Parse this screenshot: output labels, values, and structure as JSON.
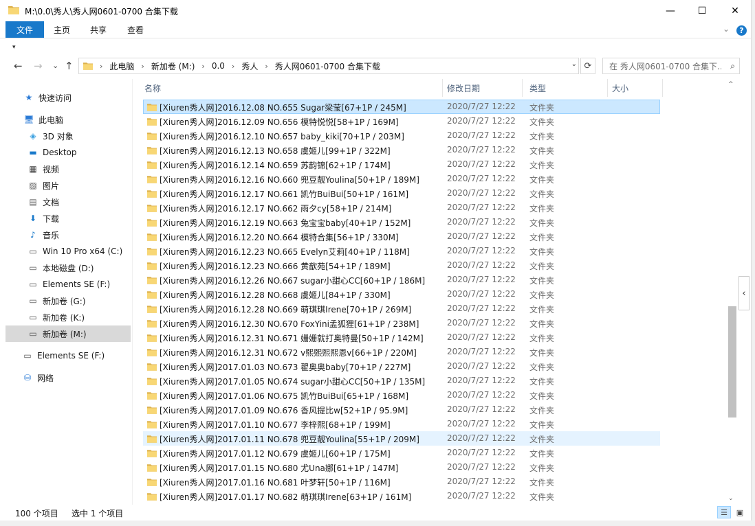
{
  "window": {
    "title": "M:\\0.0\\秀人\\秀人网0601-0700 合集下载",
    "minimize": "—",
    "maximize": "☐",
    "close": "✕"
  },
  "ribbon": {
    "tabs": [
      "文件",
      "主页",
      "共享",
      "查看"
    ],
    "expand": "⌄",
    "help": "?"
  },
  "qat": {
    "arrow": "▾"
  },
  "nav": {
    "back": "←",
    "forward": "→",
    "recent": "⌄",
    "up": "↑",
    "breadcrumbs": [
      "此电脑",
      "新加卷 (M:)",
      "0.0",
      "秀人",
      "秀人网0601-0700 合集下载"
    ],
    "breadcrumb_sep": "›",
    "address_dropdown": "⌄",
    "refresh": "⟳",
    "search_placeholder": "在 秀人网0601-0700 合集下...",
    "search_icon": "⌕"
  },
  "sidebar": {
    "items": [
      {
        "label": "快速访问",
        "icon": "star-icon",
        "glyph": "★",
        "color": "#2b7bd6"
      },
      {
        "label": "此电脑",
        "icon": "computer-icon",
        "glyph": "🖥",
        "color": "#2b7bd6"
      },
      {
        "label": "3D 对象",
        "icon": "3d-objects-icon",
        "glyph": "◈",
        "color": "#3aa0e0"
      },
      {
        "label": "Desktop",
        "icon": "desktop-icon",
        "glyph": "▬",
        "color": "#1979ca"
      },
      {
        "label": "视频",
        "icon": "video-icon",
        "glyph": "▦",
        "color": "#444"
      },
      {
        "label": "图片",
        "icon": "pictures-icon",
        "glyph": "▨",
        "color": "#555"
      },
      {
        "label": "文档",
        "icon": "documents-icon",
        "glyph": "▤",
        "color": "#666"
      },
      {
        "label": "下载",
        "icon": "download-icon",
        "glyph": "⬇",
        "color": "#1979ca"
      },
      {
        "label": "音乐",
        "icon": "music-icon",
        "glyph": "♪",
        "color": "#1979ca"
      },
      {
        "label": "Win 10 Pro x64 (C:)",
        "icon": "windows-drive-icon",
        "glyph": "▭",
        "color": "#555"
      },
      {
        "label": "本地磁盘 (D:)",
        "icon": "drive-icon",
        "glyph": "▭",
        "color": "#555"
      },
      {
        "label": "Elements SE (F:)",
        "icon": "drive-icon",
        "glyph": "▭",
        "color": "#555"
      },
      {
        "label": "新加卷 (G:)",
        "icon": "drive-icon",
        "glyph": "▭",
        "color": "#555"
      },
      {
        "label": "新加卷 (K:)",
        "icon": "drive-icon",
        "glyph": "▭",
        "color": "#555"
      },
      {
        "label": "新加卷 (M:)",
        "icon": "drive-icon",
        "glyph": "▭",
        "color": "#555"
      },
      {
        "label": "Elements SE (F:)",
        "icon": "drive-icon",
        "glyph": "▭",
        "color": "#555"
      },
      {
        "label": "网络",
        "icon": "network-icon",
        "glyph": "⛁",
        "color": "#2b7bd6"
      }
    ]
  },
  "columns": {
    "name": "名称",
    "date": "修改日期",
    "type": "类型",
    "size": "大小",
    "sort_arrow": "^"
  },
  "files": [
    {
      "name": "[Xiuren秀人网]2016.12.08 NO.655 Sugar梁莹[67+1P / 245M]",
      "date": "2020/7/27 12:22",
      "type": "文件夹"
    },
    {
      "name": "[Xiuren秀人网]2016.12.09 NO.656 模特悦悦[58+1P / 169M]",
      "date": "2020/7/27 12:22",
      "type": "文件夹"
    },
    {
      "name": "[Xiuren秀人网]2016.12.10 NO.657 baby_kiki[70+1P / 203M]",
      "date": "2020/7/27 12:22",
      "type": "文件夹"
    },
    {
      "name": "[Xiuren秀人网]2016.12.13 NO.658 虞姬儿[99+1P / 322M]",
      "date": "2020/7/27 12:22",
      "type": "文件夹"
    },
    {
      "name": "[Xiuren秀人网]2016.12.14 NO.659 苏韵锦[62+1P / 174M]",
      "date": "2020/7/27 12:22",
      "type": "文件夹"
    },
    {
      "name": "[Xiuren秀人网]2016.12.16 NO.660 兜豆靓Youlina[50+1P / 189M]",
      "date": "2020/7/27 12:22",
      "type": "文件夹"
    },
    {
      "name": "[Xiuren秀人网]2016.12.17 NO.661 凯竹BuiBui[50+1P / 161M]",
      "date": "2020/7/27 12:22",
      "type": "文件夹"
    },
    {
      "name": "[Xiuren秀人网]2016.12.17 NO.662 雨夕cy[58+1P / 214M]",
      "date": "2020/7/27 12:22",
      "type": "文件夹"
    },
    {
      "name": "[Xiuren秀人网]2016.12.19 NO.663 兔宝宝baby[40+1P / 152M]",
      "date": "2020/7/27 12:22",
      "type": "文件夹"
    },
    {
      "name": "[Xiuren秀人网]2016.12.20 NO.664 模特合集[56+1P / 330M]",
      "date": "2020/7/27 12:22",
      "type": "文件夹"
    },
    {
      "name": "[Xiuren秀人网]2016.12.23 NO.665 Evelyn艾莉[40+1P / 118M]",
      "date": "2020/7/27 12:22",
      "type": "文件夹"
    },
    {
      "name": "[Xiuren秀人网]2016.12.23 NO.666 黄歆苑[54+1P / 189M]",
      "date": "2020/7/27 12:22",
      "type": "文件夹"
    },
    {
      "name": "[Xiuren秀人网]2016.12.26 NO.667 sugar小甜心CC[60+1P / 186M]",
      "date": "2020/7/27 12:22",
      "type": "文件夹"
    },
    {
      "name": "[Xiuren秀人网]2016.12.28 NO.668 虞姬儿[84+1P / 330M]",
      "date": "2020/7/27 12:22",
      "type": "文件夹"
    },
    {
      "name": "[Xiuren秀人网]2016.12.28 NO.669 萌琪琪Irene[70+1P / 269M]",
      "date": "2020/7/27 12:22",
      "type": "文件夹"
    },
    {
      "name": "[Xiuren秀人网]2016.12.30 NO.670 FoxYini孟狐狸[61+1P / 238M]",
      "date": "2020/7/27 12:22",
      "type": "文件夹"
    },
    {
      "name": "[Xiuren秀人网]2016.12.31 NO.671 姗姗就打奥特曼[50+1P / 142M]",
      "date": "2020/7/27 12:22",
      "type": "文件夹"
    },
    {
      "name": "[Xiuren秀人网]2016.12.31 NO.672 v熙熙熙熙恩v[66+1P / 220M]",
      "date": "2020/7/27 12:22",
      "type": "文件夹"
    },
    {
      "name": "[Xiuren秀人网]2017.01.03 NO.673 翟奥奥baby[70+1P / 227M]",
      "date": "2020/7/27 12:22",
      "type": "文件夹"
    },
    {
      "name": "[Xiuren秀人网]2017.01.05 NO.674 sugar小甜心CC[50+1P / 135M]",
      "date": "2020/7/27 12:22",
      "type": "文件夹"
    },
    {
      "name": "[Xiuren秀人网]2017.01.06 NO.675 凯竹BuiBui[65+1P / 168M]",
      "date": "2020/7/27 12:22",
      "type": "文件夹"
    },
    {
      "name": "[Xiuren秀人网]2017.01.09 NO.676 香风提比w[52+1P / 95.9M]",
      "date": "2020/7/27 12:22",
      "type": "文件夹"
    },
    {
      "name": "[Xiuren秀人网]2017.01.10 NO.677 李梓熙[68+1P / 199M]",
      "date": "2020/7/27 12:22",
      "type": "文件夹"
    },
    {
      "name": "[Xiuren秀人网]2017.01.11 NO.678 兜豆靓Youlina[55+1P / 209M]",
      "date": "2020/7/27 12:22",
      "type": "文件夹"
    },
    {
      "name": "[Xiuren秀人网]2017.01.12 NO.679 虞姬儿[60+1P / 175M]",
      "date": "2020/7/27 12:22",
      "type": "文件夹"
    },
    {
      "name": "[Xiuren秀人网]2017.01.15 NO.680 尤Una娜[61+1P / 147M]",
      "date": "2020/7/27 12:22",
      "type": "文件夹"
    },
    {
      "name": "[Xiuren秀人网]2017.01.16 NO.681 叶梦轩[50+1P / 116M]",
      "date": "2020/7/27 12:22",
      "type": "文件夹"
    },
    {
      "name": "[Xiuren秀人网]2017.01.17 NO.682 萌琪琪Irene[63+1P / 161M]",
      "date": "2020/7/27 12:22",
      "type": "文件夹"
    }
  ],
  "selected_index": 0,
  "hover_index": 23,
  "status": {
    "count": "100 个项目",
    "selection": "选中 1 个项目"
  },
  "scroll": {
    "up": "^",
    "down": "⌄",
    "collapse": "‹"
  },
  "views": {
    "details": "☰",
    "thumbnails": "▣"
  },
  "colors": {
    "accent": "#1979ca",
    "folder": "#f8d775",
    "folder_dark": "#dcb14d",
    "selected": "#cce8ff",
    "hover": "#e5f3ff"
  }
}
